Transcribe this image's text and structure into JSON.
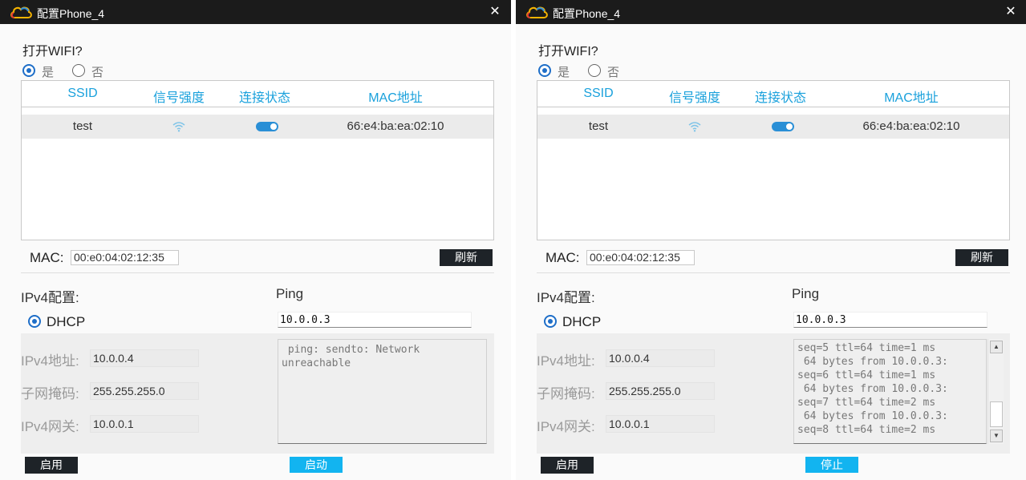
{
  "colors": {
    "accent": "#1aa1dc",
    "titlebar": "#1b1b1b",
    "toggle_on": "#2a8fd6",
    "ping_button": "#12b4f0",
    "dark_button": "#1e2328"
  },
  "windows": [
    {
      "title": "配置Phone_4",
      "close_icon": "✕",
      "wifi_question": "打开WIFI?",
      "radio_yes": "是",
      "radio_no": "否",
      "table": {
        "headers": {
          "ssid": "SSID",
          "signal": "信号强度",
          "status": "连接状态",
          "mac": "MAC地址"
        },
        "rows": [
          {
            "ssid": "test",
            "signal_icon": "wifi-signal-icon",
            "status": "connected",
            "mac": "66:e4:ba:ea:02:10"
          }
        ]
      },
      "mac_label": "MAC:",
      "mac_value": "00:e0:04:02:12:35",
      "refresh_label": "刷新",
      "ipv4_title": "IPv4配置:",
      "dhcp_label": "DHCP",
      "ipv4_address_label": "IPv4地址:",
      "ipv4_address": "10.0.0.4",
      "subnet_label": "子网掩码:",
      "subnet": "255.255.255.0",
      "gateway_label": "IPv4网关:",
      "gateway": "10.0.0.1",
      "ping_title": "Ping",
      "ping_target": "10.0.0.3",
      "ping_output": " ping: sendto: Network\nunreachable",
      "enable_label": "启用",
      "ping_button_label": "启动"
    },
    {
      "title": "配置Phone_4",
      "close_icon": "✕",
      "wifi_question": "打开WIFI?",
      "radio_yes": "是",
      "radio_no": "否",
      "table": {
        "headers": {
          "ssid": "SSID",
          "signal": "信号强度",
          "status": "连接状态",
          "mac": "MAC地址"
        },
        "rows": [
          {
            "ssid": "test",
            "signal_icon": "wifi-signal-icon",
            "status": "connected",
            "mac": "66:e4:ba:ea:02:10"
          }
        ]
      },
      "mac_label": "MAC:",
      "mac_value": "00:e0:04:02:12:35",
      "refresh_label": "刷新",
      "ipv4_title": "IPv4配置:",
      "dhcp_label": "DHCP",
      "ipv4_address_label": "IPv4地址:",
      "ipv4_address": "10.0.0.4",
      "subnet_label": "子网掩码:",
      "subnet": "255.255.255.0",
      "gateway_label": "IPv4网关:",
      "gateway": "10.0.0.1",
      "ping_title": "Ping",
      "ping_target": "10.0.0.3",
      "ping_output": " 64 bytes from 10.0.0.3:\nseq=5 ttl=64 time=1 ms\n 64 bytes from 10.0.0.3:\nseq=6 ttl=64 time=1 ms\n 64 bytes from 10.0.0.3:\nseq=7 ttl=64 time=2 ms\n 64 bytes from 10.0.0.3:\nseq=8 ttl=64 time=2 ms",
      "scroll_up_icon": "▲",
      "scroll_down_icon": "▼",
      "enable_label": "启用",
      "ping_button_label": "停止"
    }
  ]
}
